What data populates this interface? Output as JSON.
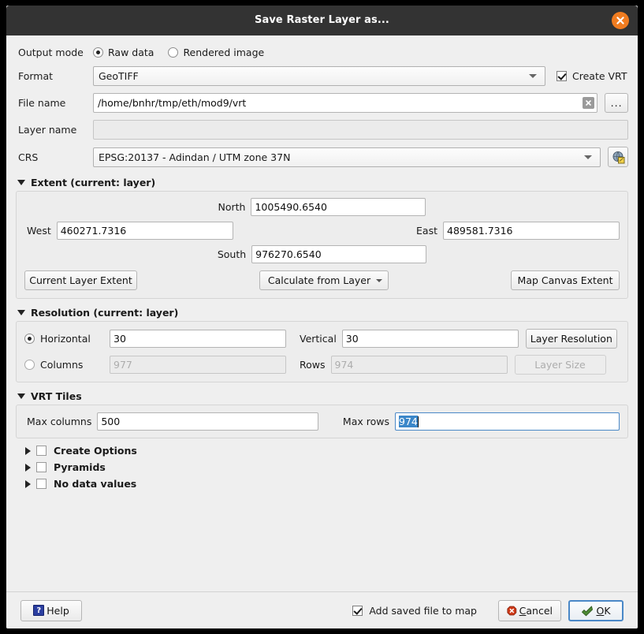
{
  "window": {
    "title": "Save Raster Layer as...",
    "close_icon": "close-circle-icon"
  },
  "form": {
    "output_mode": {
      "label": "Output mode",
      "options": [
        {
          "label": "Raw data",
          "selected": true
        },
        {
          "label": "Rendered image",
          "selected": false
        }
      ]
    },
    "format": {
      "label": "Format",
      "value": "GeoTIFF",
      "dropdown_icon": "chevron-down-icon"
    },
    "create_vrt": {
      "label": "Create VRT",
      "checked": true
    },
    "file_name": {
      "label": "File name",
      "value": "/home/bnhr/tmp/eth/mod9/vrt",
      "clear_icon": "clear-x-icon",
      "browse_label": "..."
    },
    "layer_name": {
      "label": "Layer name",
      "value": "",
      "enabled": false
    },
    "crs": {
      "label": "CRS",
      "value": "EPSG:20137 - Adindan / UTM zone 37N",
      "dropdown_icon": "chevron-down-icon",
      "select_button_icon": "crs-globe-icon"
    }
  },
  "extent": {
    "title": "Extent (current: layer)",
    "expanded": true,
    "north": {
      "label": "North",
      "value": "1005490.6540"
    },
    "west": {
      "label": "West",
      "value": "460271.7316"
    },
    "east": {
      "label": "East",
      "value": "489581.7316"
    },
    "south": {
      "label": "South",
      "value": "976270.6540"
    },
    "buttons": {
      "current_layer_extent": "Current Layer Extent",
      "calculate_from_layer": "Calculate from Layer",
      "map_canvas_extent": "Map Canvas Extent"
    }
  },
  "resolution": {
    "title": "Resolution (current: layer)",
    "expanded": true,
    "horizontal": {
      "label": "Horizontal",
      "value": "30",
      "selected": true
    },
    "vertical": {
      "label": "Vertical",
      "value": "30"
    },
    "columns": {
      "label": "Columns",
      "value": "977",
      "selected": false,
      "enabled": false
    },
    "rows": {
      "label": "Rows",
      "value": "974",
      "enabled": false
    },
    "layer_resolution_button": "Layer Resolution",
    "layer_size_button": {
      "label": "Layer Size",
      "enabled": false
    }
  },
  "vrt_tiles": {
    "title": "VRT Tiles",
    "expanded": true,
    "max_columns": {
      "label": "Max columns",
      "value": "500"
    },
    "max_rows": {
      "label": "Max rows",
      "value": "974",
      "selected_text": "974",
      "focused": true
    }
  },
  "sections": [
    {
      "label": "Create Options",
      "checked": false,
      "expanded": false
    },
    {
      "label": "Pyramids",
      "checked": false,
      "expanded": false
    },
    {
      "label": "No data values",
      "checked": false,
      "expanded": false
    }
  ],
  "footer": {
    "help": {
      "label": "Help",
      "icon": "help-question-icon"
    },
    "add_saved_file_to_map": {
      "label": "Add saved file to map",
      "checked": true
    },
    "cancel": {
      "label": "Cancel",
      "accel": "C",
      "icon": "cancel-octagon-icon"
    },
    "ok": {
      "label": "OK",
      "accel": "O",
      "icon": "ok-arrow-icon"
    }
  },
  "colors": {
    "titlebar": "#333333",
    "dialog_bg": "#efefef",
    "close_button": "#f07c20",
    "selection": "#3b87c9",
    "focus_border": "#4a88c7",
    "cancel_icon": "#cf3a18",
    "ok_icon": "#4e8b35",
    "help_icon": "#2c3fa0"
  }
}
